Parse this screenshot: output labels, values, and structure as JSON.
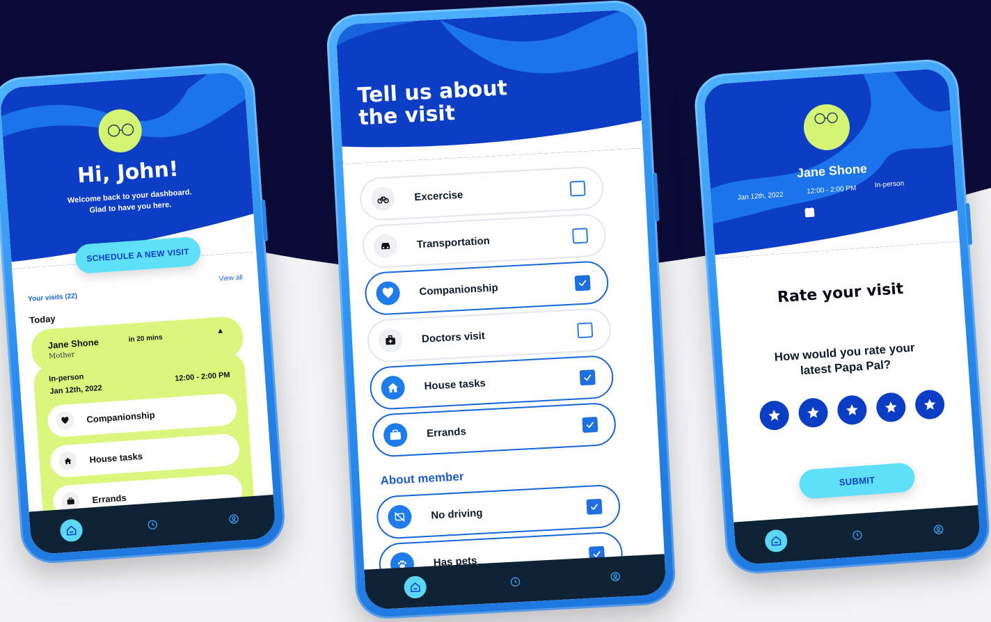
{
  "colors": {
    "navy_background": "#0b0b3a",
    "header_blue": "#0b3ec4",
    "accent_cyan": "#5fe0f8",
    "lime": "#daf67d",
    "checkbox_blue": "#1e6fe0",
    "nav_dark": "#0e2235"
  },
  "dashboard": {
    "greeting": "Hi, John!",
    "welcome_line1": "Welcome back to your dashboard.",
    "welcome_line2": "Glad to have you here.",
    "schedule_button": "SCHEDULE A NEW VISIT",
    "your_visits": "Your visits (22)",
    "view_all": "View all",
    "today": "Today",
    "visit": {
      "name": "Jane Shone",
      "relation": "Mother",
      "eta": "in 20 mins",
      "mode": "In-person",
      "date": "Jan 12th, 2022",
      "time": "12:00 - 2:00 PM",
      "services": [
        {
          "label": "Companionship",
          "icon": "heart-icon"
        },
        {
          "label": "House tasks",
          "icon": "home-icon"
        },
        {
          "label": "Errands",
          "icon": "briefcase-icon"
        }
      ]
    },
    "nav": [
      "home-icon",
      "clock-icon",
      "profile-icon"
    ]
  },
  "visit_form": {
    "title_line1": "Tell us about",
    "title_line2": "the visit",
    "options": [
      {
        "label": "Excercise",
        "icon": "bicycle-icon",
        "checked": false
      },
      {
        "label": "Transportation",
        "icon": "car-icon",
        "checked": false
      },
      {
        "label": "Companionship",
        "icon": "heart-icon",
        "checked": true
      },
      {
        "label": "Doctors visit",
        "icon": "medical-bag-icon",
        "checked": false
      },
      {
        "label": "House tasks",
        "icon": "home-icon",
        "checked": true
      },
      {
        "label": "Errands",
        "icon": "briefcase-icon",
        "checked": true
      }
    ],
    "member_heading": "About member",
    "member_options": [
      {
        "label": "No driving",
        "icon": "no-car-icon",
        "checked": true
      },
      {
        "label": "Has pets",
        "icon": "paw-icon",
        "checked": true
      }
    ],
    "nav": [
      "home-icon",
      "clock-icon",
      "profile-icon"
    ]
  },
  "rating": {
    "name": "Jane Shone",
    "date": "Jan 12th, 2022",
    "time": "12:00 - 2:00 PM",
    "mode": "In-person",
    "header_icons": [
      "heart-icon",
      "briefcase-icon",
      "home-icon"
    ],
    "title": "Rate your visit",
    "question_line1": "How would you rate your",
    "question_line2": "latest Papa Pal?",
    "star_count": 5,
    "submit": "SUBMIT",
    "nav": [
      "home-icon",
      "clock-icon",
      "profile-icon"
    ]
  }
}
